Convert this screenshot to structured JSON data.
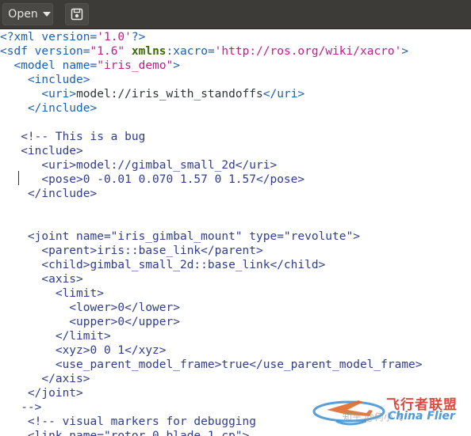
{
  "toolbar": {
    "open_label": "Open",
    "save_icon": "save-icon"
  },
  "editor": {
    "lines": [
      [
        {
          "c": "punc",
          "t": "<?"
        },
        {
          "c": "tag",
          "t": "xml "
        },
        {
          "c": "attr",
          "t": "version"
        },
        {
          "c": "punc",
          "t": "="
        },
        {
          "c": "str",
          "t": "'1.0'"
        },
        {
          "c": "punc",
          "t": "?>"
        }
      ],
      [
        {
          "c": "punc",
          "t": "<"
        },
        {
          "c": "tag",
          "t": "sdf "
        },
        {
          "c": "attr",
          "t": "version"
        },
        {
          "c": "punc",
          "t": "="
        },
        {
          "c": "str",
          "t": "\"1.6\" "
        },
        {
          "c": "ns",
          "t": "xmlns"
        },
        {
          "c": "attr",
          "t": ":xacro"
        },
        {
          "c": "punc",
          "t": "="
        },
        {
          "c": "str",
          "t": "'http://ros.org/wiki/xacro'"
        },
        {
          "c": "punc",
          "t": ">"
        }
      ],
      [
        {
          "c": "txt",
          "t": "  "
        },
        {
          "c": "punc",
          "t": "<"
        },
        {
          "c": "tag",
          "t": "model "
        },
        {
          "c": "attr",
          "t": "name"
        },
        {
          "c": "punc",
          "t": "="
        },
        {
          "c": "str",
          "t": "\"iris_demo\""
        },
        {
          "c": "punc",
          "t": ">"
        }
      ],
      [
        {
          "c": "txt",
          "t": "    "
        },
        {
          "c": "punc",
          "t": "<"
        },
        {
          "c": "tag",
          "t": "include"
        },
        {
          "c": "punc",
          "t": ">"
        }
      ],
      [
        {
          "c": "txt",
          "t": "      "
        },
        {
          "c": "punc",
          "t": "<"
        },
        {
          "c": "tag",
          "t": "uri"
        },
        {
          "c": "punc",
          "t": ">"
        },
        {
          "c": "txt",
          "t": "model://iris_with_standoffs"
        },
        {
          "c": "punc",
          "t": "</"
        },
        {
          "c": "tag",
          "t": "uri"
        },
        {
          "c": "punc",
          "t": ">"
        }
      ],
      [
        {
          "c": "txt",
          "t": "    "
        },
        {
          "c": "punc",
          "t": "</"
        },
        {
          "c": "tag",
          "t": "include"
        },
        {
          "c": "punc",
          "t": ">"
        }
      ],
      [],
      [
        {
          "c": "cmt",
          "t": "   <!-- This is a bug"
        }
      ],
      [
        {
          "c": "cmt",
          "t": "   <include>"
        }
      ],
      [
        {
          "c": "cmt",
          "t": "      <uri>model://gimbal_small_2d</uri>"
        }
      ],
      [
        {
          "c": "cmt",
          "t": "      <pose>0 -0.01 0.070 1.57 0 1.57</pose>"
        }
      ],
      [
        {
          "c": "cmt",
          "t": "    </include>"
        }
      ],
      [],
      [],
      [
        {
          "c": "cmt",
          "t": "    <joint name=\"iris_gimbal_mount\" type=\"revolute\">"
        }
      ],
      [
        {
          "c": "cmt",
          "t": "      <parent>iris::base_link</parent>"
        }
      ],
      [
        {
          "c": "cmt",
          "t": "      <child>gimbal_small_2d::base_link</child>"
        }
      ],
      [
        {
          "c": "cmt",
          "t": "      <axis>"
        }
      ],
      [
        {
          "c": "cmt",
          "t": "        <limit>"
        }
      ],
      [
        {
          "c": "cmt",
          "t": "          <lower>0</lower>"
        }
      ],
      [
        {
          "c": "cmt",
          "t": "          <upper>0</upper>"
        }
      ],
      [
        {
          "c": "cmt",
          "t": "        </limit>"
        }
      ],
      [
        {
          "c": "cmt",
          "t": "        <xyz>0 0 1</xyz>"
        }
      ],
      [
        {
          "c": "cmt",
          "t": "        <use_parent_model_frame>true</use_parent_model_frame>"
        }
      ],
      [
        {
          "c": "cmt",
          "t": "      </axis>"
        }
      ],
      [
        {
          "c": "cmt",
          "t": "    </joint>"
        }
      ],
      [
        {
          "c": "cmt",
          "t": "   -->"
        }
      ],
      [
        {
          "c": "cmt",
          "t": "    <!-- visual markers for debugging"
        }
      ],
      [
        {
          "c": "cmt",
          "t": "    <link name=\"rotor_0_blade_1_cp\">"
        }
      ]
    ]
  },
  "watermark": {
    "brand_cn": "飞行者联盟",
    "brand_en": "China Flier",
    "zhihu": "知乎 @何小飞"
  },
  "colors": {
    "toolbar_bg": "#3c3b37",
    "tag": "#1a5fb4",
    "string": "#c01c8a",
    "comment": "#2f3d8c"
  }
}
